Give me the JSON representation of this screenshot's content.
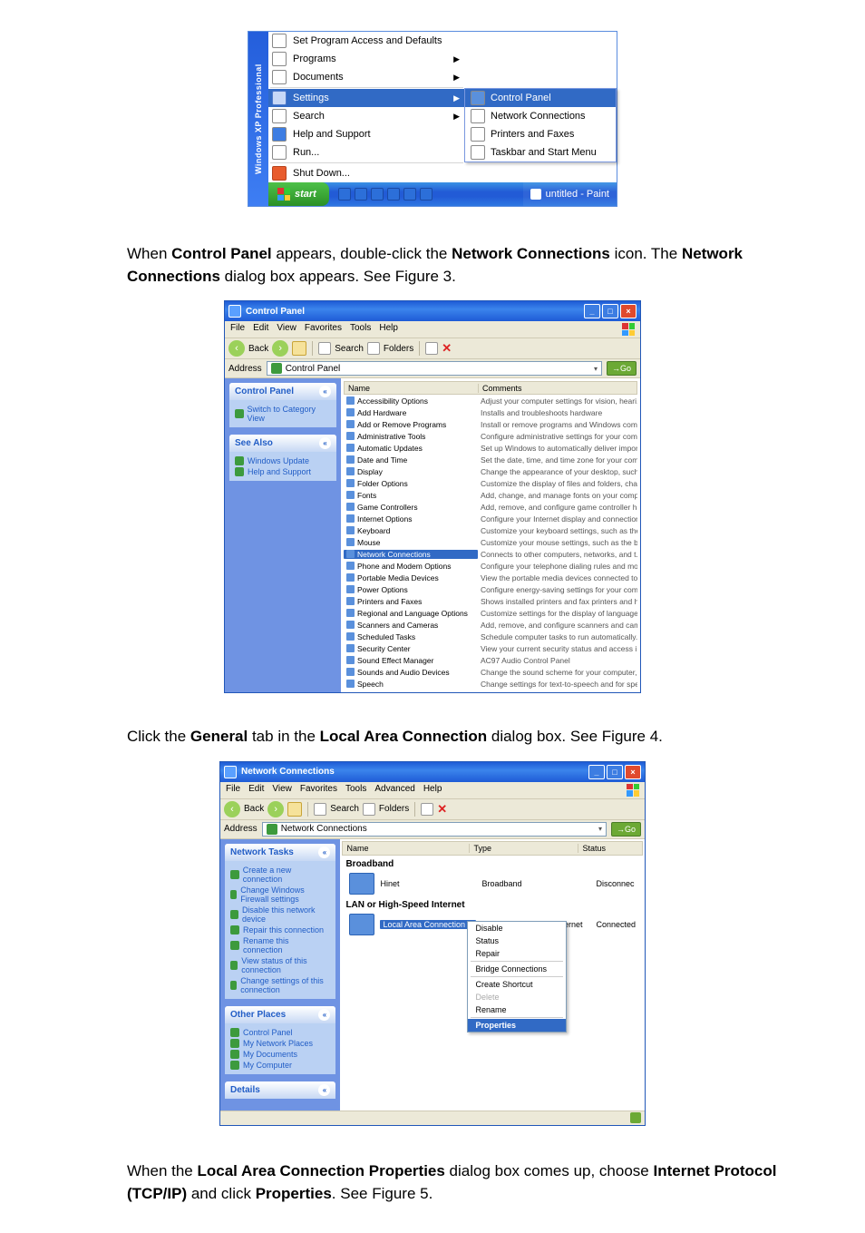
{
  "fig1": {
    "stripe": "Windows XP Professional",
    "items": [
      {
        "label": "Set Program Access and Defaults",
        "arrow": false
      },
      {
        "label": "Programs",
        "arrow": true
      },
      {
        "label": "Documents",
        "arrow": true
      },
      {
        "label": "Settings",
        "arrow": true,
        "hl": true
      },
      {
        "label": "Search",
        "arrow": true
      },
      {
        "label": "Help and Support",
        "arrow": false
      },
      {
        "label": "Run...",
        "arrow": false
      },
      {
        "label": "Shut Down...",
        "arrow": false
      }
    ],
    "submenu": [
      {
        "label": "Control Panel",
        "hl": true
      },
      {
        "label": "Network Connections"
      },
      {
        "label": "Printers and Faxes"
      },
      {
        "label": "Taskbar and Start Menu"
      }
    ],
    "start": "start",
    "task": "untitled - Paint"
  },
  "para1": {
    "pre": "When ",
    "b1": "Control Panel",
    "mid": " appears, double-click the ",
    "b2": "Network Connections",
    "post": " icon. The ",
    "b3": "Network Connections",
    "post2": " dialog box appears. See Figure 3."
  },
  "fig2": {
    "title": "Control Panel",
    "menus": [
      "File",
      "Edit",
      "View",
      "Favorites",
      "Tools",
      "Help"
    ],
    "toolbar": {
      "back": "Back",
      "search": "Search",
      "folders": "Folders"
    },
    "address_label": "Address",
    "address_value": "Control Panel",
    "go": "Go",
    "side": {
      "box1": {
        "head": "Control Panel",
        "items": [
          "Switch to Category View"
        ]
      },
      "box2": {
        "head": "See Also",
        "items": [
          "Windows Update",
          "Help and Support"
        ]
      }
    },
    "cols": {
      "name": "Name",
      "comments": "Comments"
    },
    "rows": [
      {
        "n": "Accessibility Options",
        "c": "Adjust your computer settings for vision, heari..."
      },
      {
        "n": "Add Hardware",
        "c": "Installs and troubleshoots hardware"
      },
      {
        "n": "Add or Remove Programs",
        "c": "Install or remove programs and Windows com..."
      },
      {
        "n": "Administrative Tools",
        "c": "Configure administrative settings for your com..."
      },
      {
        "n": "Automatic Updates",
        "c": "Set up Windows to automatically deliver import..."
      },
      {
        "n": "Date and Time",
        "c": "Set the date, time, and time zone for your com..."
      },
      {
        "n": "Display",
        "c": "Change the appearance of your desktop, such ..."
      },
      {
        "n": "Folder Options",
        "c": "Customize the display of files and folders, chan..."
      },
      {
        "n": "Fonts",
        "c": "Add, change, and manage fonts on your comp..."
      },
      {
        "n": "Game Controllers",
        "c": "Add, remove, and configure game controller ha..."
      },
      {
        "n": "Internet Options",
        "c": "Configure your Internet display and connection..."
      },
      {
        "n": "Keyboard",
        "c": "Customize your keyboard settings, such as the..."
      },
      {
        "n": "Mouse",
        "c": "Customize your mouse settings, such as the b..."
      },
      {
        "n": "Network Connections",
        "c": "Connects to other computers, networks, and t...",
        "sel": true
      },
      {
        "n": "Phone and Modem Options",
        "c": "Configure your telephone dialing rules and mod..."
      },
      {
        "n": "Portable Media Devices",
        "c": "View the portable media devices connected to ..."
      },
      {
        "n": "Power Options",
        "c": "Configure energy-saving settings for your com..."
      },
      {
        "n": "Printers and Faxes",
        "c": "Shows installed printers and fax printers and hel..."
      },
      {
        "n": "Regional and Language Options",
        "c": "Customize settings for the display of languages..."
      },
      {
        "n": "Scanners and Cameras",
        "c": "Add, remove, and configure scanners and cam..."
      },
      {
        "n": "Scheduled Tasks",
        "c": "Schedule computer tasks to run automatically."
      },
      {
        "n": "Security Center",
        "c": "View your current security status and access i..."
      },
      {
        "n": "Sound Effect Manager",
        "c": "AC97 Audio Control Panel"
      },
      {
        "n": "Sounds and Audio Devices",
        "c": "Change the sound scheme for your computer,..."
      },
      {
        "n": "Speech",
        "c": "Change settings for text-to-speech and for spe..."
      }
    ]
  },
  "para2": {
    "pre": "Click the ",
    "b1": "General",
    "mid": " tab in the ",
    "b2": "Local Area Connection",
    "post": " dialog box. See Figure 4."
  },
  "fig3": {
    "title": "Network Connections",
    "menus": [
      "File",
      "Edit",
      "View",
      "Favorites",
      "Tools",
      "Advanced",
      "Help"
    ],
    "toolbar": {
      "back": "Back",
      "search": "Search",
      "folders": "Folders"
    },
    "address_label": "Address",
    "address_value": "Network Connections",
    "go": "Go",
    "cols": {
      "name": "Name",
      "type": "Type",
      "status": "Status"
    },
    "side": {
      "box1": {
        "head": "Network Tasks",
        "items": [
          "Create a new connection",
          "Change Windows Firewall settings",
          "Disable this network device",
          "Repair this connection",
          "Rename this connection",
          "View status of this connection",
          "Change settings of this connection"
        ]
      },
      "box2": {
        "head": "Other Places",
        "items": [
          "Control Panel",
          "My Network Places",
          "My Documents",
          "My Computer"
        ]
      },
      "box3": {
        "head": "Details",
        "items": []
      }
    },
    "groups": [
      {
        "label": "Broadband",
        "items": [
          {
            "name": "Hinet",
            "type": "Broadband",
            "status": "Disconnec"
          }
        ]
      },
      {
        "label": "LAN or High-Speed Internet",
        "items": [
          {
            "name": "Local Area Connection",
            "type": "LAN or High-Speed Internet",
            "status": "Connected",
            "sel": true
          }
        ]
      }
    ],
    "ctx": [
      "Disable",
      "Status",
      "Repair",
      "",
      "Bridge Connections",
      "",
      "Create Shortcut",
      "Delete",
      "Rename",
      "",
      "Properties"
    ],
    "ctx_hl": "Properties",
    "ctx_dis": "Delete"
  },
  "para3": {
    "pre": "When the ",
    "b1": "Local Area Connection Properties",
    "mid": " dialog box comes up, choose ",
    "b2": "Internet Protocol (TCP/IP)",
    "mid2": " and click ",
    "b3": "Properties",
    "post": ". See Figure 5."
  }
}
